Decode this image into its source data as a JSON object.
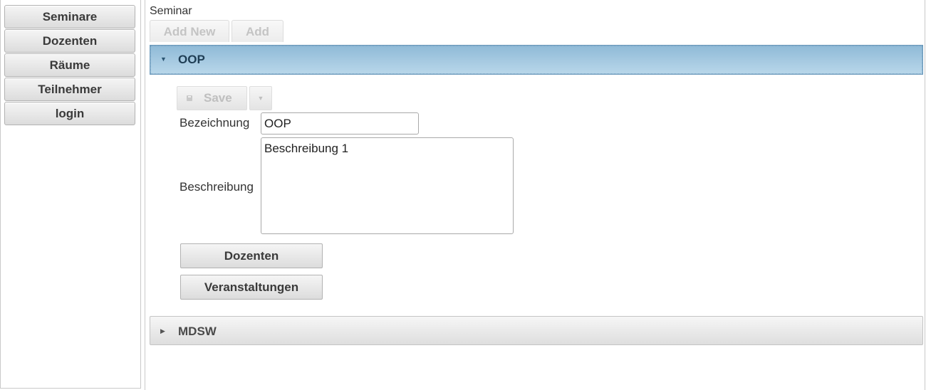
{
  "sidebar": {
    "items": [
      {
        "label": "Seminare"
      },
      {
        "label": "Dozenten"
      },
      {
        "label": "Räume"
      },
      {
        "label": "Teilnehmer"
      },
      {
        "label": "login"
      }
    ]
  },
  "main": {
    "title": "Seminar",
    "toolbar": {
      "add_new_label": "Add New",
      "add_label": "Add"
    },
    "accordion": [
      {
        "title": "OOP",
        "expanded": true,
        "form": {
          "save_label": "Save",
          "bezeichnung_label": "Bezeichnung",
          "bezeichnung_value": "OOP",
          "beschreibung_label": "Beschreibung",
          "beschreibung_value": "Beschreibung 1",
          "dozenten_button": "Dozenten",
          "veranstaltungen_button": "Veranstaltungen"
        }
      },
      {
        "title": "MDSW",
        "expanded": false
      }
    ]
  },
  "colors": {
    "active_header_top": "#8fbad7",
    "active_header_bottom": "#b9d7ea",
    "active_header_text": "#1f3e55",
    "button_text": "#3a3a3a",
    "disabled_text": "#c4c4c4"
  },
  "icons": {
    "expanded_arrow": "triangle-down-icon",
    "collapsed_arrow": "triangle-right-icon",
    "save": "floppy-disk-icon",
    "save_menu": "chevron-down-icon"
  }
}
